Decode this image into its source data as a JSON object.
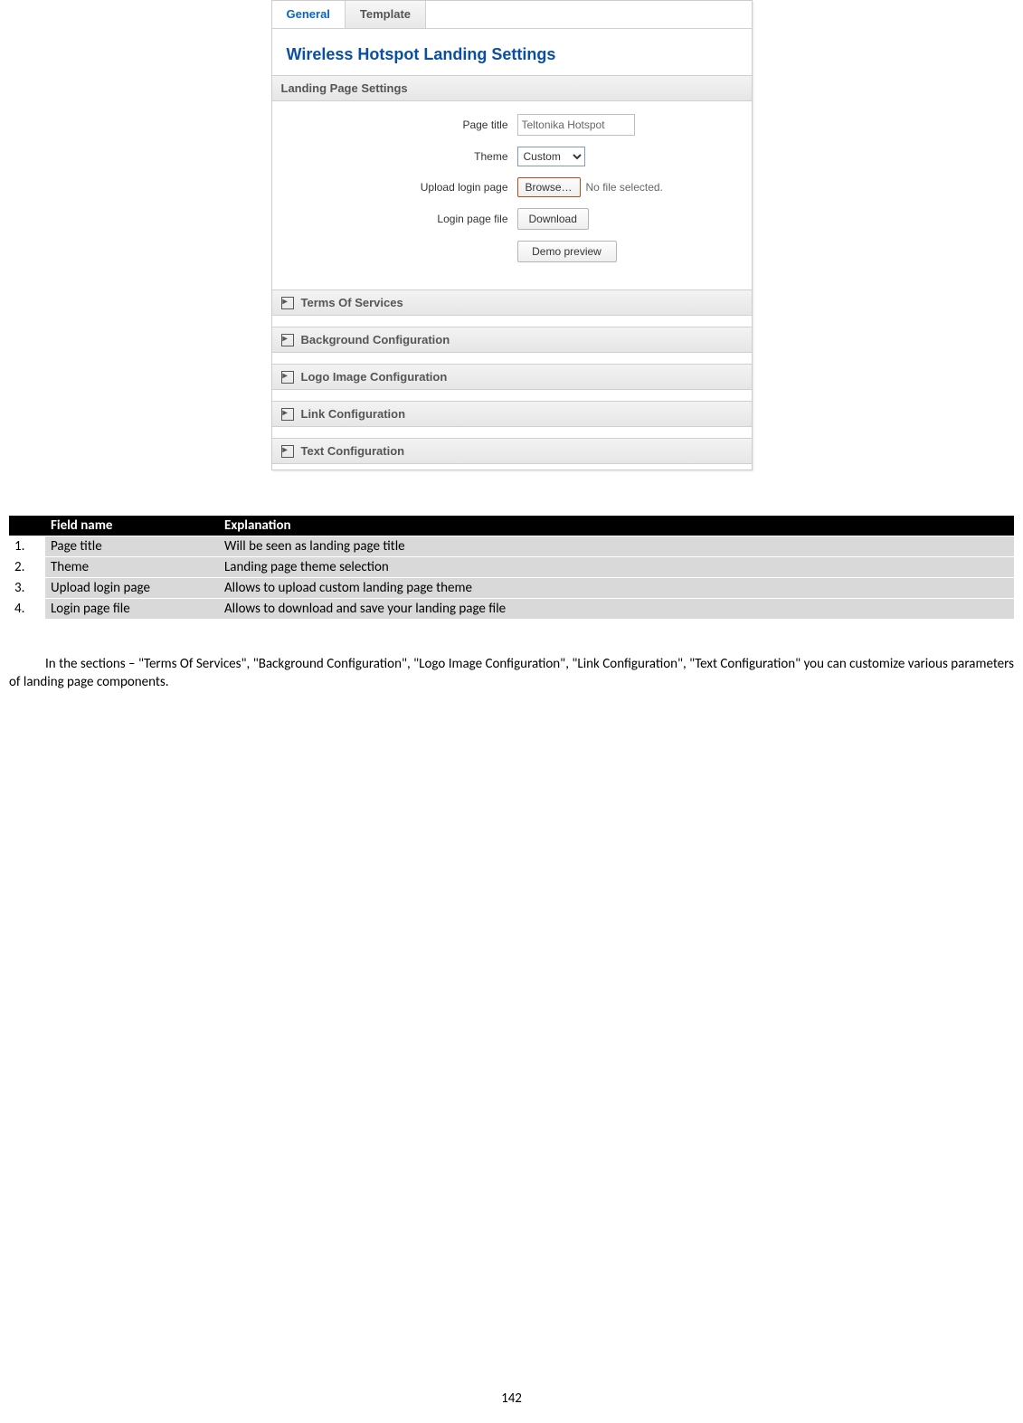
{
  "tabs": {
    "general": "General",
    "template": "Template"
  },
  "heading": "Wireless Hotspot Landing Settings",
  "sections": {
    "landing": "Landing Page Settings",
    "tos": "Terms Of Services",
    "bg": "Background Configuration",
    "logo": "Logo Image Configuration",
    "link": "Link Configuration",
    "text": "Text Configuration"
  },
  "form": {
    "page_title_label": "Page title",
    "page_title_value": "Teltonika Hotspot",
    "theme_label": "Theme",
    "theme_value": "Custom",
    "upload_label": "Upload login page",
    "browse_label": "Browse…",
    "no_file": "No file selected.",
    "login_file_label": "Login page file",
    "download_label": "Download",
    "demo_label": "Demo preview"
  },
  "table": {
    "headers": {
      "num": "",
      "name": "Field name",
      "expl": "Explanation"
    },
    "rows": [
      {
        "num": "1.",
        "name": "Page title",
        "expl": "Will be seen as landing page title"
      },
      {
        "num": "2.",
        "name": "Theme",
        "expl": "Landing page theme selection"
      },
      {
        "num": "3.",
        "name": "Upload login page",
        "expl": "Allows to upload custom landing page theme"
      },
      {
        "num": "4.",
        "name": "Login page file",
        "expl": "Allows to download and save your landing page file"
      }
    ]
  },
  "body_text": "In the sections – \"Terms Of Services\", \"Background Configuration\", \"Logo Image Configuration\", \"Link Configuration\", \"Text Configuration\" you can customize various parameters of landing page components.",
  "page_number": "142"
}
